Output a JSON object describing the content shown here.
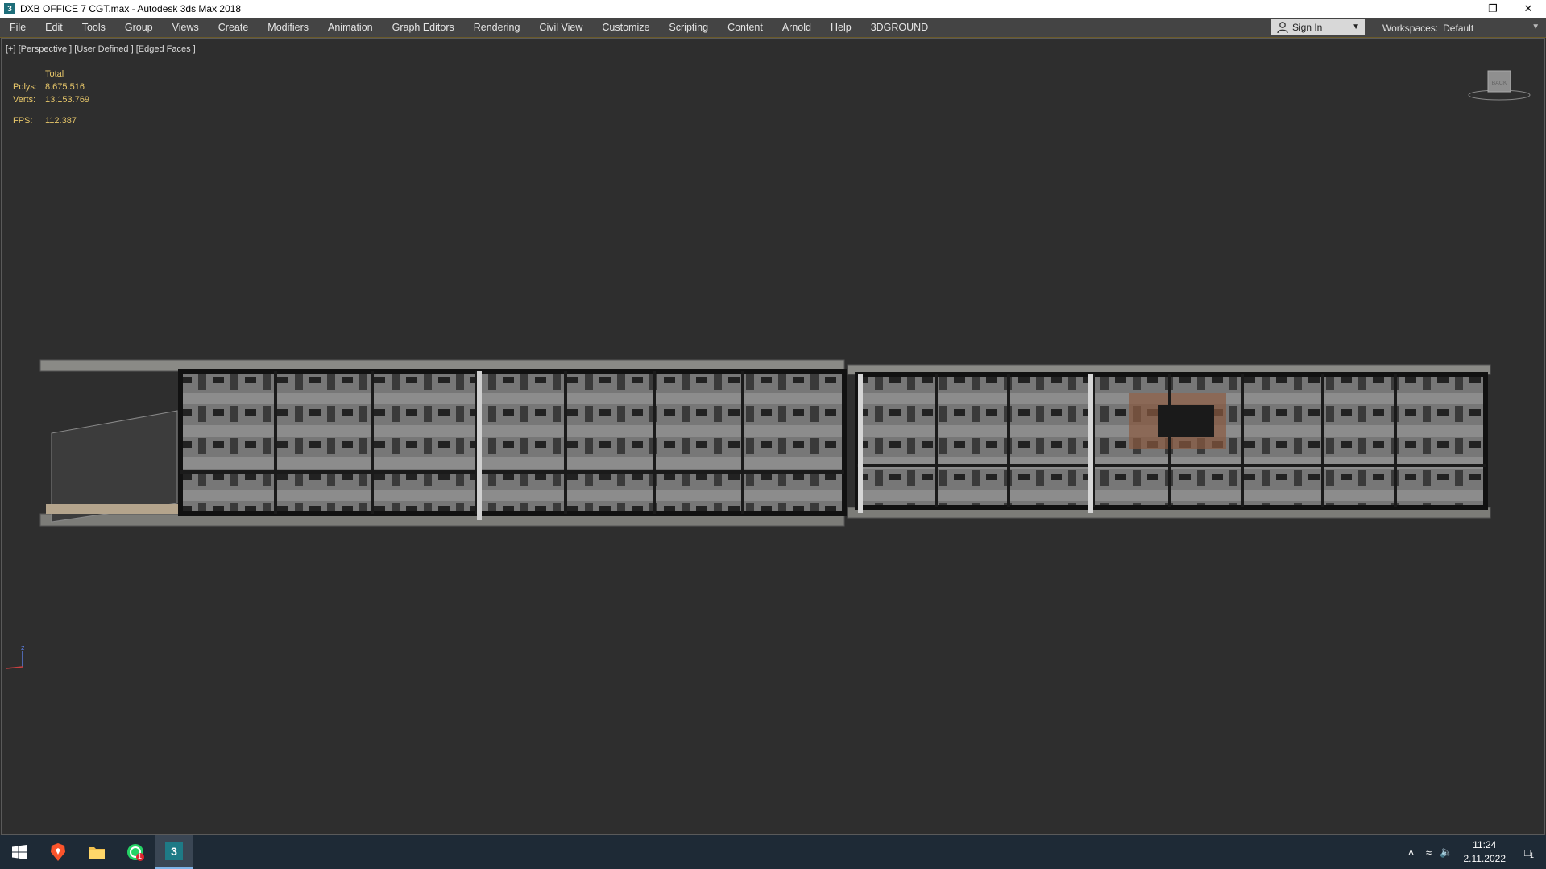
{
  "window": {
    "title": "DXB OFFICE 7 CGT.max - Autodesk 3ds Max 2018",
    "icon": "3ds-max-icon",
    "controls": [
      "minimize-icon",
      "restore-icon",
      "close-icon"
    ]
  },
  "menu": {
    "items": [
      "File",
      "Edit",
      "Tools",
      "Group",
      "Views",
      "Create",
      "Modifiers",
      "Animation",
      "Graph Editors",
      "Rendering",
      "Civil View",
      "Customize",
      "Scripting",
      "Content",
      "Arnold",
      "Help",
      "3DGROUND"
    ],
    "signin_label": "Sign In",
    "workspaces_label": "Workspaces:",
    "workspace_value": "Default"
  },
  "viewport": {
    "label": "[+] [Perspective ] [User Defined ] [Edged Faces ]",
    "stats": {
      "total_label": "Total",
      "polys_label": "Polys:",
      "polys_value": "8.675.516",
      "verts_label": "Verts:",
      "verts_value": "13.153.769",
      "fps_label": "FPS:",
      "fps_value": "112.387"
    },
    "viewcube_label": "BACK",
    "axis_label": "z",
    "colors": {
      "background": "#2e2e2e",
      "stats_text": "#e9c86a"
    }
  },
  "taskbar": {
    "apps": [
      "windows-start-icon",
      "brave-browser-icon",
      "file-explorer-icon",
      "whatsapp-icon",
      "3ds-max-taskbar-icon"
    ],
    "whatsapp_badge": "1",
    "time": "11:24",
    "date": "2.11.2022",
    "notification_count": "1"
  }
}
